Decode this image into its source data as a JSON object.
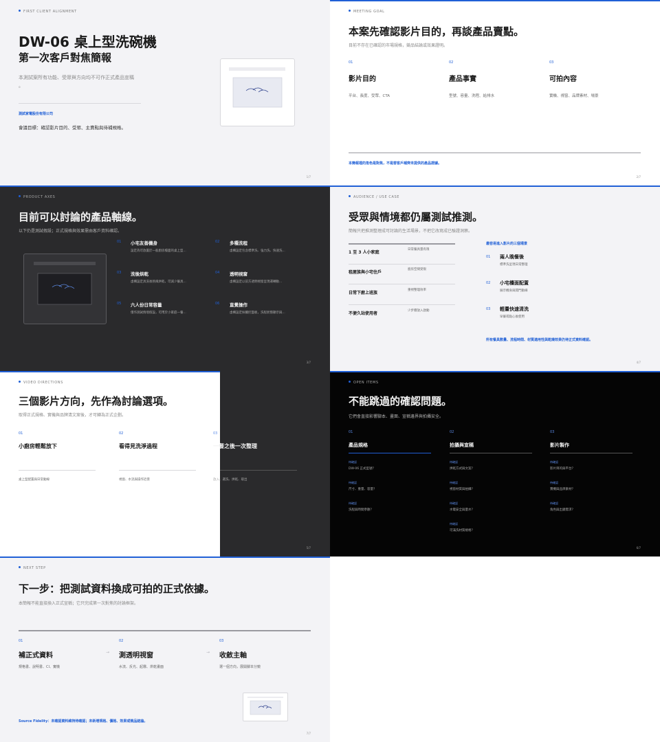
{
  "slide1": {
    "kicker": "FIRST CLIENT ALIGNMENT",
    "title": "DW-06 桌上型洗碗機",
    "subtitle": "第一次客戶對焦簡報",
    "note_line1": "本測試案所有功能、受眾與方向均不可作正式產品宣稱",
    "note_line2": "。",
    "company": "測試家電股份有限公司",
    "meeting_goal": "會議目標：確認影片目的、受眾、主賣點與待補規格。",
    "page": "1/7"
  },
  "slide2": {
    "kicker": "MEETING GOAL",
    "title": "本案先確認影片目的，再談產品賣點。",
    "subtitle": "目前不存在已確認的市場規格，競品結論或效果證明。",
    "cols": [
      {
        "num": "01",
        "title": "影片目的",
        "desc": "平台、長度、受眾、CTA"
      },
      {
        "num": "02",
        "title": "產品事實",
        "desc": "型號、容量、洗程、給排水"
      },
      {
        "num": "03",
        "title": "可拍內容",
        "desc": "實機、視窗、品牌素材、場景"
      }
    ],
    "footer": "本簡報裡的角色是對焦，不是替客戶補齊未提供的產品證據。",
    "page": "2/7"
  },
  "slide3": {
    "kicker": "PRODUCT AXES",
    "title": "目前可以討論的產品軸線。",
    "subtitle": "以下仍是測試假設；正式規格與效果需由客戶資料確認。",
    "items": [
      {
        "num": "01",
        "title": "小宅友善機身",
        "desc": "設定為可放置於一般廚房檯面的桌上型..."
      },
      {
        "num": "02",
        "title": "多種洗程",
        "desc": "虛構設定包含標準洗、強力洗、快速洗..."
      },
      {
        "num": "03",
        "title": "洗後烘乾",
        "desc": "虛構設定具洗後熱風烘乾，可減少餐具..."
      },
      {
        "num": "04",
        "title": "透明視窗",
        "desc": "虛構設定以前方透明視窗呈現運轉動..."
      },
      {
        "num": "05",
        "title": "六人份日常容量",
        "desc": "僅作測試情境假設，可用於小家庭一餐..."
      },
      {
        "num": "06",
        "title": "直覺操作",
        "desc": "虛構設定採觸控面板，洗程狀態顯示與..."
      }
    ],
    "page": "3/7"
  },
  "slide4": {
    "kicker": "AUDIENCE / USE CASE",
    "title": "受眾與情境都仍屬測試推測。",
    "subtitle": "簡報只把推測整理成可討論的生活場景，不把它改寫成已驗證洞察。",
    "rows": [
      {
        "label": "1 至 3 人小家庭",
        "desc": "日常餐具量有限"
      },
      {
        "label": "租屋族與小宅住戶",
        "desc": "廚房空間受限"
      },
      {
        "label": "日常下廚上班族",
        "desc": "重視整理效率"
      },
      {
        "label": "不便久站使用者",
        "desc": "少步驟放入啟動"
      }
    ],
    "right_title": "最容易進入影片的三個場景",
    "scenes": [
      {
        "num": "01",
        "title": "兩人晚餐後",
        "desc": "標準洗呈現日常整理"
      },
      {
        "num": "02",
        "title": "小宅檯面配置",
        "desc": "展示機身與開門動線"
      },
      {
        "num": "03",
        "title": "輕量快速清洗",
        "desc": "早餐或點心後使用"
      }
    ],
    "footer": "所有餐具數量、洗程時間、材質適用性與乾燥效果仍待正式資料確認。",
    "page": "4/7"
  },
  "slide5": {
    "kicker": "VIDEO DIRECTIONS",
    "title": "三個影片方向，先作為討論選項。",
    "subtitle": "取得正式規格、實機與品牌清文案後，才可轉為正式企劃。",
    "cols": [
      {
        "num": "01",
        "title": "小廚房輕鬆放下",
        "desc": "桌上型配置與日常動線"
      },
      {
        "num": "02",
        "title": "看得見洗淨過程",
        "desc": "視窗、水流與操作近景"
      },
      {
        "num": "03",
        "title": "一餐之後一次整理",
        "desc": "放入、選洗、烘乾、取出"
      }
    ],
    "page": "5/7"
  },
  "slide6": {
    "kicker": "OPEN ITEMS",
    "title": "不能跳過的確認問題。",
    "subtitle": "它們會直接影響腳本、畫面、宣稱邊界與拍攝安全。",
    "cols": [
      {
        "num": "01",
        "title": "產品規格",
        "items": [
          {
            "tag": "待確認",
            "text": "DW-06 正式型號？"
          },
          {
            "tag": "待確認",
            "text": "尺寸、重量、容量？"
          },
          {
            "tag": "待確認",
            "text": "洗程與時間參數？"
          }
        ]
      },
      {
        "num": "02",
        "title": "拍攝與宣稱",
        "items": [
          {
            "tag": "待確認",
            "text": "烘乾方式與文案？"
          },
          {
            "tag": "待確認",
            "text": "視窗材質與拍攝？"
          },
          {
            "tag": "待確認",
            "text": "水電安全與量水？"
          },
          {
            "tag": "待確認",
            "text": "可滿洗材質規格？"
          }
        ]
      },
      {
        "num": "03",
        "title": "影片製作",
        "items": [
          {
            "tag": "待確認",
            "text": "影片目的與平台？"
          },
          {
            "tag": "待確認",
            "text": "實機與品牌素材？"
          },
          {
            "tag": "待確認",
            "text": "角色與出鏡需求？"
          }
        ]
      }
    ],
    "page": "6/7"
  },
  "slide7": {
    "kicker": "NEXT STEP",
    "title": "下一步：把測試資料換成可拍的正式依據。",
    "subtitle": "本簡報不能直接換入正式宣稱；它只完成第一次對焦的討論框架。",
    "steps": [
      {
        "num": "01",
        "title": "補正式資料",
        "desc": "規格書、說明書、CI、實機"
      },
      {
        "num": "02",
        "title": "測透明視窗",
        "desc": "水流、反光、起霧、烘乾畫面"
      },
      {
        "num": "03",
        "title": "收斂主軸",
        "desc": "選一個方向，展開腳本分鏡"
      }
    ],
    "footer": "Source Fidelity：未確認資料維持待確認；未新增規格、價格、效果或競品結論。",
    "page": "7/7"
  },
  "colors": {
    "accent": "#1f5fd6",
    "light_bg": "#f3f3f6",
    "dark_bg": "#2a2a2c",
    "black_bg": "#050505"
  }
}
